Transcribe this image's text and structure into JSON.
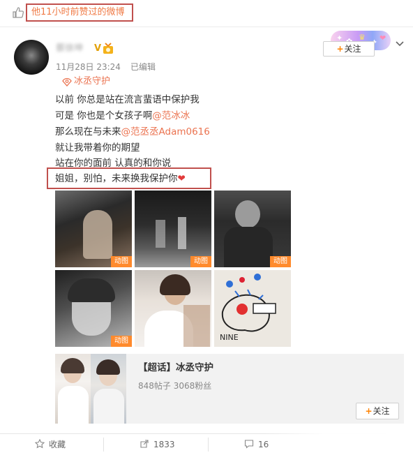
{
  "liked_header": {
    "text": "他11小时前赞过的微博"
  },
  "author": {
    "name": "蔡徐坤",
    "verified_badge": "V",
    "timestamp": "11月28日 23:24",
    "edited": "已编辑",
    "follow_label": "关注"
  },
  "location_tag": {
    "label": "冰丞守护"
  },
  "post": {
    "lines": [
      {
        "pre": "以前 你总是站在流言蜚语中保护我",
        "mention": "",
        "post": ""
      },
      {
        "pre": "可是 你也是个女孩子啊",
        "mention": "@范冰冰",
        "post": ""
      },
      {
        "pre": "那么现在与未来",
        "mention": "@范丞丞Adam0616",
        "post": ""
      },
      {
        "pre": "就让我带着你的期望",
        "mention": "",
        "post": ""
      },
      {
        "pre": "站在你的面前 认真的和你说",
        "mention": "",
        "post": ""
      }
    ],
    "highlight_line": "姐姐，别怕，未来换我保护你"
  },
  "images": [
    {
      "gif_label": "动图"
    },
    {
      "gif_label": "动图"
    },
    {
      "gif_label": "动图"
    },
    {
      "gif_label": "动图"
    },
    {
      "gif_label": ""
    },
    {
      "gif_label": ""
    }
  ],
  "topic_card": {
    "prefix": "【超话】",
    "name": "冰丞守护",
    "stats": "848帖子 3068粉丝",
    "follow_label": "关注"
  },
  "actions": {
    "favorite": "收藏",
    "repost": "1833",
    "comment": "16"
  },
  "colors": {
    "accent_orange": "#ff8200",
    "mention": "#eb7350",
    "highlight_box": "#c0504d"
  }
}
